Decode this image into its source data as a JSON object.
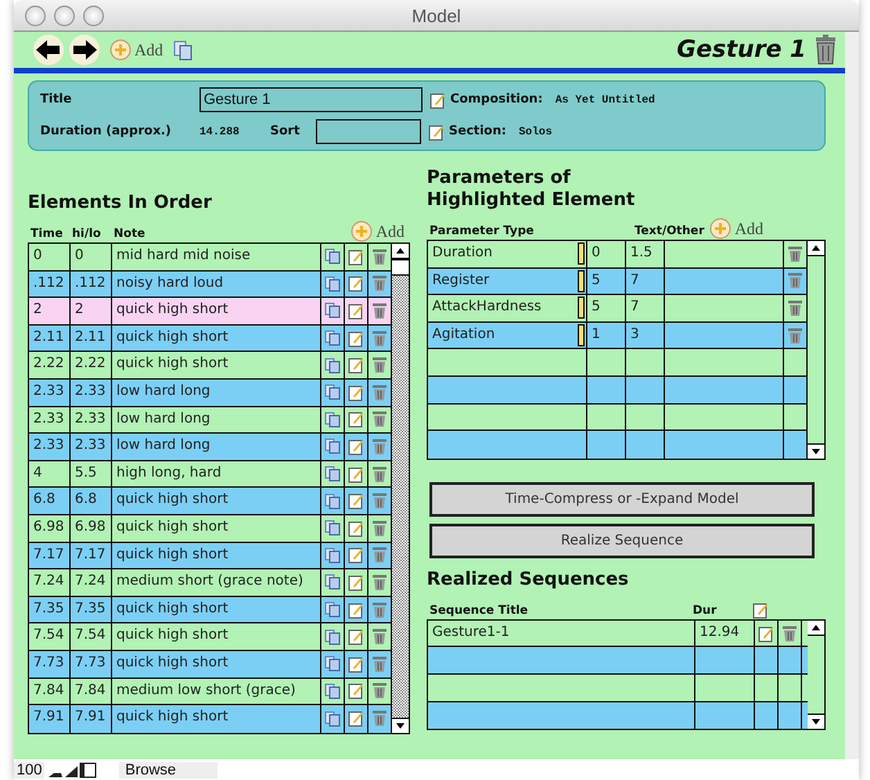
{
  "window": {
    "title": "Model"
  },
  "toolbar": {
    "add_label": "Add",
    "record_title": "Gesture 1"
  },
  "info": {
    "title_label": "Title",
    "title_value": "Gesture 1",
    "composition_label": "Composition:",
    "composition_value": "As Yet Untitled",
    "duration_label": "Duration (approx.)",
    "duration_value": "14.288",
    "sort_label": "Sort",
    "section_label": "Section:",
    "section_value": "Solos"
  },
  "elements": {
    "heading": "Elements In Order",
    "add_label": "Add",
    "columns": [
      "Time",
      "hi/lo",
      "Note"
    ],
    "rows": [
      {
        "time": "0",
        "hilo": "0",
        "note": "mid hard mid noise",
        "selected": false
      },
      {
        "time": ".112",
        "hilo": ".112",
        "note": "noisy hard loud",
        "selected": false
      },
      {
        "time": "2",
        "hilo": "2",
        "note": "quick high short",
        "selected": true
      },
      {
        "time": "2.11",
        "hilo": "2.11",
        "note": "quick high short",
        "selected": false
      },
      {
        "time": "2.22",
        "hilo": "2.22",
        "note": "quick high short",
        "selected": false
      },
      {
        "time": "2.33",
        "hilo": "2.33",
        "note": "low hard long",
        "selected": false
      },
      {
        "time": "2.33",
        "hilo": "2.33",
        "note": "low hard long",
        "selected": false
      },
      {
        "time": "2.33",
        "hilo": "2.33",
        "note": "low hard long",
        "selected": false
      },
      {
        "time": "4",
        "hilo": "5.5",
        "note": "high long, hard",
        "selected": false
      },
      {
        "time": "6.8",
        "hilo": "6.8",
        "note": "quick high short",
        "selected": false
      },
      {
        "time": "6.98",
        "hilo": "6.98",
        "note": "quick high short",
        "selected": false
      },
      {
        "time": "7.17",
        "hilo": "7.17",
        "note": "quick high short",
        "selected": false
      },
      {
        "time": "7.24",
        "hilo": "7.24",
        "note": "medium short (grace note)",
        "selected": false
      },
      {
        "time": "7.35",
        "hilo": "7.35",
        "note": "quick high short",
        "selected": false
      },
      {
        "time": "7.54",
        "hilo": "7.54",
        "note": "quick high short",
        "selected": false
      },
      {
        "time": "7.73",
        "hilo": "7.73",
        "note": "quick high short",
        "selected": false
      },
      {
        "time": "7.84",
        "hilo": "7.84",
        "note": "medium low short (grace)",
        "selected": false
      },
      {
        "time": "7.91",
        "hilo": "7.91",
        "note": "quick high short",
        "selected": false
      }
    ]
  },
  "parameters": {
    "heading_line_1": "Parameters of",
    "heading_line_2": "Highlighted Element",
    "add_label": "Add",
    "columns": [
      "Parameter Type",
      "Text/Other"
    ],
    "rows": [
      {
        "type": "Duration",
        "low": "0",
        "high": "1.5"
      },
      {
        "type": "Register",
        "low": "5",
        "high": "7"
      },
      {
        "type": "AttackHardness",
        "low": "5",
        "high": "7"
      },
      {
        "type": "Agitation",
        "low": "1",
        "high": "3"
      }
    ]
  },
  "buttons": [
    "Time-Compress or -Expand Model",
    "Realize Sequence"
  ],
  "sequences": {
    "heading": "Realized Sequences",
    "columns": [
      "Sequence Title",
      "Dur"
    ],
    "rows": [
      {
        "title": "Gesture1-1",
        "dur": "12.94"
      }
    ]
  },
  "status_bar": {
    "zoom": "100",
    "mode": "Browse"
  }
}
